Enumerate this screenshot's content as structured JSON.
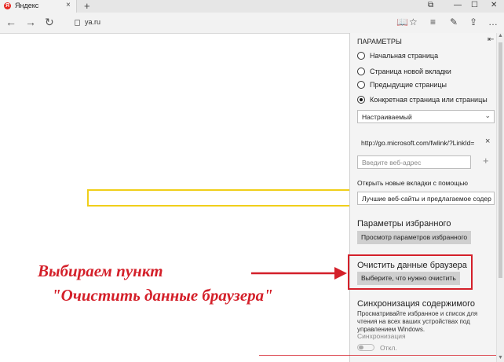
{
  "tab": {
    "icon_letter": "Я",
    "title": "Яндекс",
    "close": "×",
    "new_tab": "+"
  },
  "window_controls": {
    "tabs": "⧉",
    "minimize": "—",
    "maximize": "☐",
    "close": "✕"
  },
  "address": {
    "back": "←",
    "forward": "→",
    "refresh": "↻",
    "url": "ya.ru"
  },
  "toolbar": {
    "reading_view": "📖",
    "favorite": "☆",
    "hub": "≡",
    "notes": "✎",
    "share": "⇪",
    "more": "…"
  },
  "settings": {
    "title": "ПАРАМЕТРЫ",
    "pin": "⇤",
    "open_with_options": [
      {
        "label": "Начальная страница",
        "selected": false
      },
      {
        "label": "Страница новой вкладки",
        "selected": false
      },
      {
        "label": "Предыдущие страницы",
        "selected": false
      },
      {
        "label": "Конкретная страница или страницы",
        "selected": true
      }
    ],
    "page_select": "Настраиваемый",
    "custom_url": "http://go.microsoft.com/fwlink/?LinkId=",
    "remove": "×",
    "web_address_placeholder": "Введите веб-адрес",
    "add": "+",
    "new_tabs_label": "Открыть новые вкладки с помощью",
    "new_tabs_select": "Лучшие веб-сайты и предлагаемое содер",
    "favorites_heading": "Параметры избранного",
    "favorites_button": "Просмотр параметров избранного",
    "clear_heading": "Очистить данные браузера",
    "clear_button": "Выберите, что нужно очистить",
    "sync_heading": "Синхронизация содержимого",
    "sync_desc": "Просматривайте избранное и список для чтения на всех ваших устройствах под управлением Windows.",
    "sync_label": "Синхронизация",
    "sync_toggle_state": "Откл."
  },
  "annotation": {
    "line1": "Выбираем пункт",
    "line2": "\"Очистить данные браузера\"",
    "color": "#d4202a"
  },
  "colors": {
    "search_border": "#f0cf1a",
    "panel_bg": "#f4f4f4"
  }
}
